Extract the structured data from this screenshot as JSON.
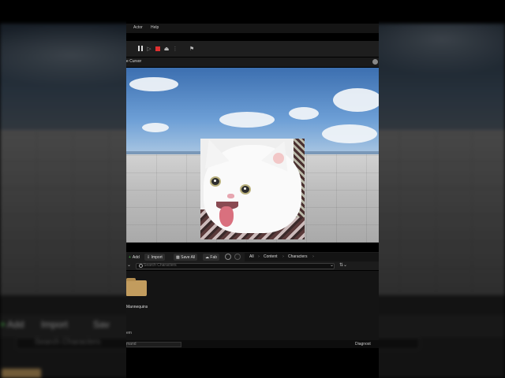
{
  "menu": {
    "items": [
      "Actor",
      "Help"
    ]
  },
  "toolbar": {
    "pause_icon": "pause-icon",
    "play_icon": "play-icon",
    "stop_icon": "stop-icon",
    "eject_icon": "eject-icon",
    "flag_icon": "flag-icon"
  },
  "viewport": {
    "title": "e Cursor"
  },
  "content_browser": {
    "add_label": "Add",
    "import_label": "Import",
    "save_all_label": "Save All",
    "fab_label": "Fab",
    "breadcrumbs": [
      "All",
      "Content",
      "Characters"
    ],
    "search_placeholder": "Search Characters",
    "folder_label": "Mannequins",
    "items_label": "em"
  },
  "statusbar": {
    "cmd_placeholder": "mand",
    "diagnostics": "Diagnost"
  },
  "background": {
    "add_label": "Add",
    "import_label": "Import",
    "save_label": "Sav",
    "search_placeholder": "Search Characters"
  },
  "colors": {
    "stop_red": "#e03030",
    "add_green": "#4cc24c",
    "folder": "#c29c5e"
  }
}
